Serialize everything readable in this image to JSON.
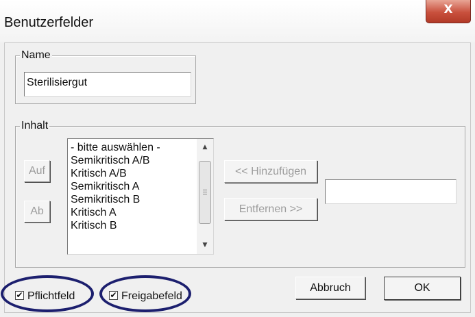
{
  "window": {
    "title": "Benutzerfelder",
    "close_glyph": "X"
  },
  "name_group": {
    "label": "Name",
    "value": "Sterilisiergut"
  },
  "inhalt_group": {
    "label": "Inhalt",
    "up_button": "Auf",
    "down_button": "Ab",
    "list_items": [
      "- bitte auswählen -",
      "Semikritisch A/B",
      "Kritisch A/B",
      "Semikritisch A",
      "Semikritisch B",
      "Kritisch A",
      "Kritisch B"
    ],
    "add_button": "<< Hinzufügen",
    "remove_button": "Entfernen >>",
    "new_entry_value": ""
  },
  "options": {
    "pflichtfeld_label": "Pflichtfeld",
    "pflichtfeld_checked": true,
    "freigabefeld_label": "Freigabefeld",
    "freigabefeld_checked": true,
    "check_glyph": "✔"
  },
  "actions": {
    "cancel_button": "Abbruch",
    "ok_button": "OK"
  },
  "colors": {
    "close_button": "#c9503d",
    "highlight_ellipse": "#1c1f6e",
    "disabled_text": "#9c9c9c"
  },
  "icons": {
    "scroll_up": "triangle-up-icon",
    "scroll_down": "triangle-down-icon",
    "close": "close-icon",
    "check": "checkmark-icon"
  }
}
